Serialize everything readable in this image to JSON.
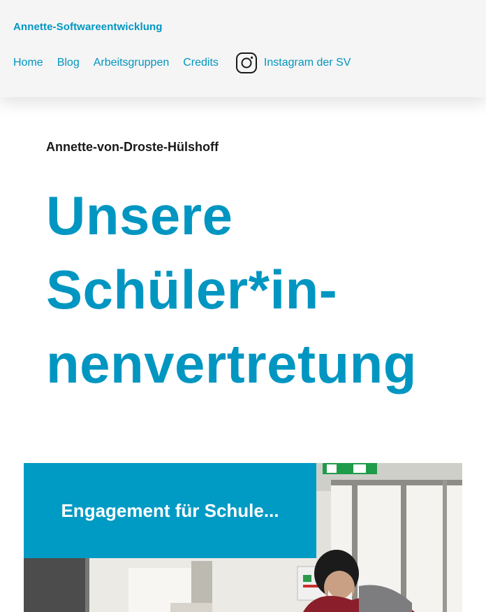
{
  "header": {
    "brand": "Annette-Softwareentwicklung",
    "nav": [
      {
        "label": "Home"
      },
      {
        "label": "Blog"
      },
      {
        "label": "Arbeitsgruppen"
      },
      {
        "label": "Credits"
      }
    ],
    "instagram_label": "Instagram der SV",
    "instagram_icon": "instagram-icon"
  },
  "hero": {
    "subtitle": "Annette-von-Droste-Hülshoff",
    "title_line1": "Unsere",
    "title_line2": "Schüler*in-",
    "title_line3": "nenvertretung"
  },
  "feature": {
    "caption": "Engagement für Schule..."
  },
  "colors": {
    "accent": "#0096c1",
    "header_bg": "#f5f5f5",
    "overlay_bg": "#009bc4"
  }
}
